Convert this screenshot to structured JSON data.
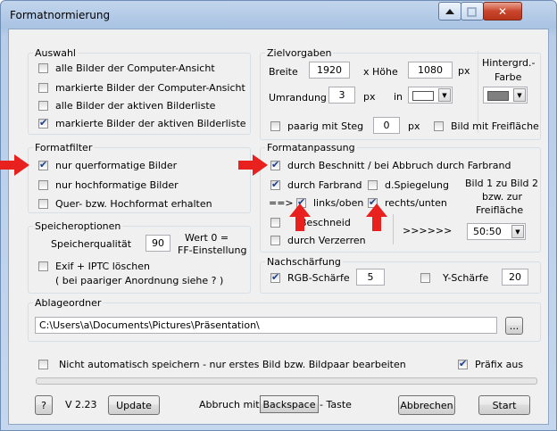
{
  "window": {
    "title": "Formatnormierung"
  },
  "auswahl": {
    "legend": "Auswahl",
    "options": [
      {
        "label": "alle Bilder der Computer-Ansicht",
        "checked": false
      },
      {
        "label": "markierte Bilder der Computer-Ansicht",
        "checked": false
      },
      {
        "label": "alle Bilder der aktiven Bilderliste",
        "checked": false
      },
      {
        "label": "markierte Bilder der aktiven Bilderliste",
        "checked": true
      }
    ]
  },
  "formatfilter": {
    "legend": "Formatfilter",
    "options": [
      {
        "label": "nur querformatige Bilder",
        "checked": true
      },
      {
        "label": "nur hochformatige Bilder",
        "checked": false
      },
      {
        "label": "Quer- bzw. Hochformat erhalten",
        "checked": false
      }
    ]
  },
  "speicheroptionen": {
    "legend": "Speicheroptionen",
    "quality_label": "Speicherqualität",
    "quality_value": "90",
    "hint_line1": "Wert 0 =",
    "hint_line2": "FF-Einstellung",
    "exif_label": "Exif + IPTC löschen",
    "exif_checked": false,
    "exif_note": "( bei paariger Anordnung siehe ? )"
  },
  "zielvorgaben": {
    "legend": "Zielvorgaben",
    "breite_label": "Breite",
    "breite_value": "1920",
    "hoehe_label": "x Höhe",
    "hoehe_value": "1080",
    "px": "px",
    "umrandung_label": "Umrandung",
    "umrandung_value": "3",
    "in_label": "in",
    "paarig_label": "paarig mit Steg",
    "paarig_checked": false,
    "steg_value": "0",
    "freiflaeche_label": "Bild mit Freifläche",
    "freiflaeche_checked": false,
    "hintergrund_line1": "Hintergrd.-",
    "hintergrund_line2": "Farbe"
  },
  "formatanpassung": {
    "legend": "Formatanpassung",
    "beschnitt_label": "durch Beschnitt / bei Abbruch durch Farbrand",
    "beschnitt_checked": true,
    "farbrand_label": "durch Farbrand",
    "farbrand_checked": true,
    "spiegelung_label": "d.Spiegelung",
    "spiegelung_checked": false,
    "arrow_text": "==>",
    "linksoben_label": "links/oben",
    "linksoben_checked": true,
    "rechtsunten_label": "rechts/unten",
    "rechtsunten_checked": true,
    "beschneid_label": "Beschneid",
    "beschneid_checked": false,
    "verzerren_label": "durch Verzerren",
    "verzerren_checked": false,
    "chevrons": ">>>>>>",
    "ratio_line1": "Bild 1 zu Bild 2",
    "ratio_line2": "bzw. zur",
    "ratio_line3": "Freifläche",
    "ratio_value": "50:50"
  },
  "nachschaerfung": {
    "legend": "Nachschärfung",
    "rgb_label": "RGB-Schärfe",
    "rgb_checked": true,
    "rgb_value": "5",
    "y_label": "Y-Schärfe",
    "y_checked": false,
    "y_value": "20"
  },
  "ablageordner": {
    "legend": "Ablageordner",
    "path": "C:\\Users\\a\\Documents\\Pictures\\Präsentation\\",
    "browse_label": "..."
  },
  "options": {
    "nicht_speichern_label": "Nicht automatisch speichern - nur erstes Bild bzw. Bildpaar bearbeiten",
    "nicht_speichern_checked": false,
    "praefix_label": "Präfix aus",
    "praefix_checked": true
  },
  "footer": {
    "help_label": "?",
    "version": "V 2.23",
    "update_label": "Update",
    "abbruch_prefix": "Abbruch mit",
    "backspace_label": "Backspace",
    "abbruch_suffix": "- Taste",
    "abbrechen_label": "Abbrechen",
    "start_label": "Start"
  },
  "colors": {
    "annotation_arrow": "#e8211e",
    "background_swatch": "#808080"
  }
}
